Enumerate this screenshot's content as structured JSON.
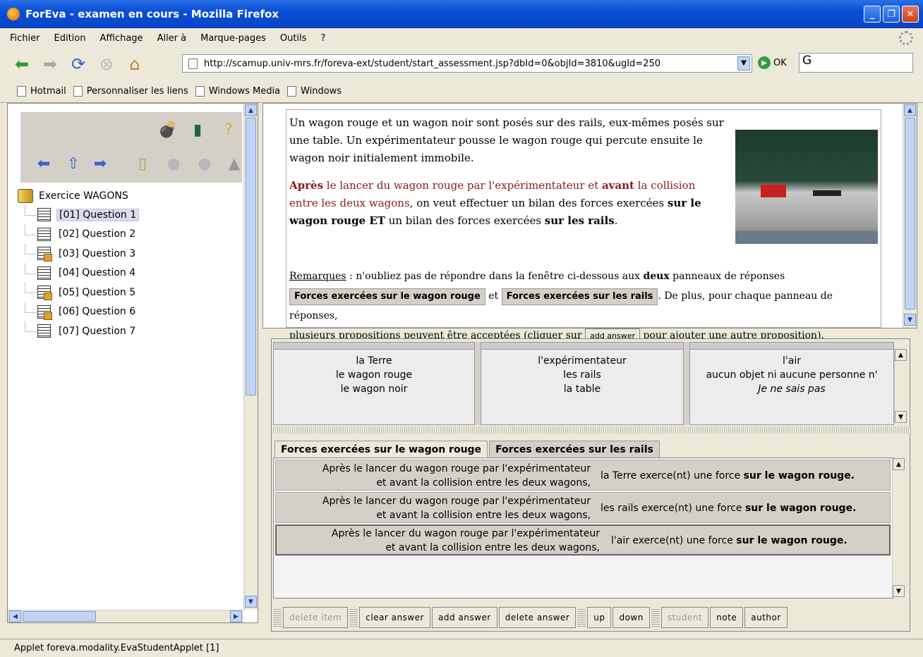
{
  "window": {
    "title": "ForEva - examen en cours - Mozilla Firefox"
  },
  "menu": [
    "Fichier",
    "Edition",
    "Affichage",
    "Aller à",
    "Marque-pages",
    "Outils",
    "?"
  ],
  "nav": {
    "url": "http://scamup.univ-mrs.fr/foreva-ext/student/start_assessment.jsp?dbId=0&objId=3810&ugId=250",
    "go_label": "OK"
  },
  "bookmarks": [
    "Hotmail",
    "Personnaliser les liens",
    "Windows Media",
    "Windows"
  ],
  "tree": {
    "root": "Exercice WAGONS",
    "items": [
      {
        "label": "[01] Question 1",
        "selected": true,
        "locked": false
      },
      {
        "label": "[02] Question 2",
        "selected": false,
        "locked": false
      },
      {
        "label": "[03] Question 3",
        "selected": false,
        "locked": true
      },
      {
        "label": "[04] Question 4",
        "selected": false,
        "locked": false
      },
      {
        "label": "[05] Question 5",
        "selected": false,
        "locked": true
      },
      {
        "label": "[06] Question 6",
        "selected": false,
        "locked": true
      },
      {
        "label": "[07] Question 7",
        "selected": false,
        "locked": false
      }
    ]
  },
  "question": {
    "intro": "Un wagon rouge et un wagon noir sont posés sur des rails, eux-mêmes posés sur une table. Un expérimentateur pousse le wagon rouge qui percute ensuite le wagon noir initialement immobile.",
    "p2_apres": "Après",
    "p2_a": " le lancer du wagon rouge par l'expérimentateur et ",
    "p2_avant": "avant",
    "p2_b": " la collision entre les deux wagons",
    "p2_c": ", on veut effectuer un bilan des forces exercées ",
    "p2_d": "sur le wagon rouge ET",
    "p2_e": " un bilan des forces exercées ",
    "p2_f": "sur les rails",
    "p2_g": ".",
    "remarks_label": "Remarques",
    "remarks_a": " : n'oubliez pas de répondre dans la fenêtre ci-dessous aux ",
    "remarks_deux": "deux",
    "remarks_b": " panneaux de réponses",
    "tab1": "Forces exercées sur le wagon rouge",
    "et": "et",
    "tab2": "Forces exercées sur les rails",
    "remarks_c": ". De plus, pour chaque panneau de réponses,",
    "remarks_d": "plusieurs propositions peuvent être acceptées (cliquer sur ",
    "add_answer": "add answer",
    "remarks_e": " pour ajouter une autre proposition)."
  },
  "choices": [
    [
      "la Terre",
      "le wagon rouge",
      "le wagon noir"
    ],
    [
      "l'expérimentateur",
      "les rails",
      "la table"
    ],
    [
      "l'air",
      "aucun objet ni aucune personne n'",
      "Je ne sais pas"
    ]
  ],
  "tabs": [
    "Forces exercées sur le wagon rouge",
    "Forces exercées sur les rails"
  ],
  "answers": [
    {
      "left1": "Après le lancer du  wagon rouge par l'expérimentateur",
      "left2": "et avant la collision entre les deux wagons,",
      "right_a": "la Terre exerce(nt) une force ",
      "right_b": "sur le wagon rouge."
    },
    {
      "left1": "Après le lancer du  wagon rouge par l'expérimentateur",
      "left2": "et avant la collision entre les deux wagons,",
      "right_a": "les rails exerce(nt) une force ",
      "right_b": "sur le wagon rouge."
    },
    {
      "left1": "Après le lancer du  wagon rouge par l'expérimentateur",
      "left2": "et avant la collision entre les deux wagons,",
      "right_a": "l'air exerce(nt) une force ",
      "right_b": "sur le wagon rouge."
    }
  ],
  "buttons": {
    "delete_item": "delete item",
    "clear_answer": "clear answer",
    "add_answer": "add answer",
    "delete_answer": "delete answer",
    "up": "up",
    "down": "down",
    "student": "student",
    "note": "note",
    "author": "author"
  },
  "status": "Applet foreva.modality.EvaStudentApplet [1]"
}
